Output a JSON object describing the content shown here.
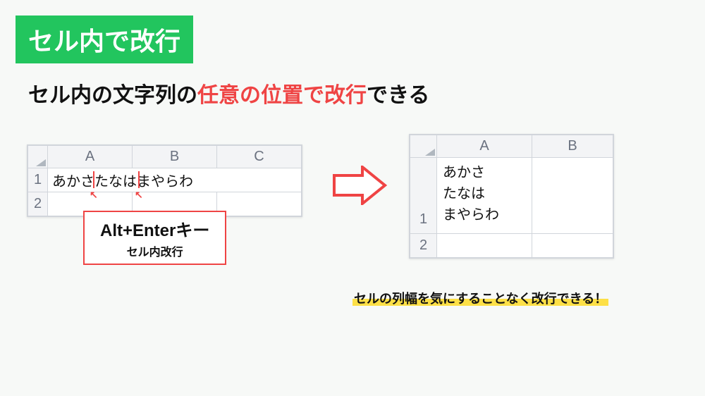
{
  "title": "セル内で改行",
  "subtitle": {
    "pre": "セル内の文字列の",
    "emphasis": "任意の位置で改行",
    "post": "できる"
  },
  "left_sheet": {
    "columns": [
      "A",
      "B",
      "C"
    ],
    "rows": [
      "1",
      "2"
    ],
    "cellA1_text": "あかさたなはまやらわ"
  },
  "right_sheet": {
    "columns": [
      "A",
      "B"
    ],
    "rows": [
      "1",
      "2"
    ],
    "cellA1_lines": {
      "l1": "あかさ",
      "l2": "たなは",
      "l3": "まやらわ"
    }
  },
  "callout": {
    "key": "Alt+Enterキー",
    "sub": "セル内改行"
  },
  "footer": "セルの列幅を気にすることなく改行できる！"
}
